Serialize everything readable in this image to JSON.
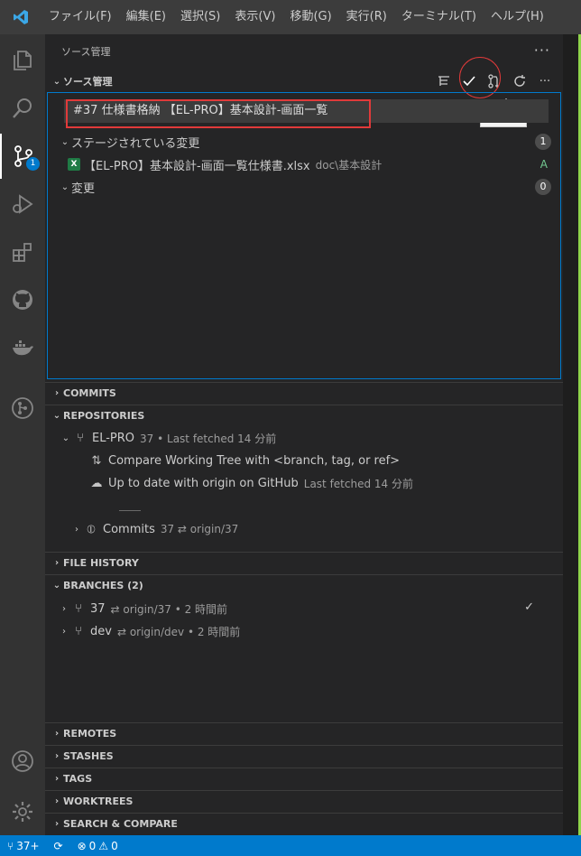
{
  "menu": [
    "ファイル(F)",
    "編集(E)",
    "選択(S)",
    "表示(V)",
    "移動(G)",
    "実行(R)",
    "ターミナル(T)",
    "ヘルプ(H)"
  ],
  "activity": {
    "scm_badge": "1"
  },
  "view": {
    "title": "ソース管理",
    "more": "···"
  },
  "scm": {
    "header": "ソース管理",
    "tooltip": "コミット",
    "commit_message": "#37 仕様書格納 【EL-PRO】基本設計-画面一覧",
    "staged": {
      "label": "ステージされている変更",
      "count": "1"
    },
    "staged_file": {
      "name": "【EL-PRO】基本設計-画面一覧仕様書.xlsx",
      "path": "doc\\基本設計",
      "status": "A"
    },
    "changes": {
      "label": "変更",
      "count": "0"
    }
  },
  "sections": {
    "commits": "COMMITS",
    "repositories": "REPOSITORIES",
    "file_history": "FILE HISTORY",
    "branches": "BRANCHES (2)",
    "remotes": "REMOTES",
    "stashes": "STASHES",
    "tags": "TAGS",
    "worktrees": "WORKTREES",
    "search_compare": "SEARCH & COMPARE"
  },
  "repo": {
    "name": "EL-PRO",
    "meta": "37 • Last fetched 14 分前",
    "compare": "Compare Working Tree with <branch, tag, or ref>",
    "uptodate": "Up to date with origin on GitHub",
    "uptodate_meta": "Last fetched 14 分前",
    "commits_label": "Commits",
    "commits_meta": "37 ⇄ origin/37"
  },
  "branches": [
    {
      "name": "37",
      "meta": "⇄ origin/37 • 2 時間前"
    },
    {
      "name": "dev",
      "meta": "⇄ origin/dev • 2 時間前"
    }
  ],
  "statusbar": {
    "branch": "37+",
    "errors": "0",
    "warnings": "0"
  },
  "colors": {
    "accent": "#007acc",
    "highlight": "#e03a3a",
    "added": "#73c991"
  }
}
